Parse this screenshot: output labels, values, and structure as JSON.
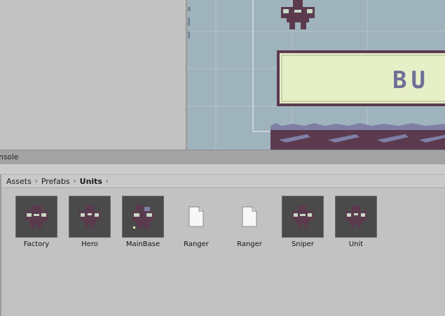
{
  "console_tab": {
    "label": "onsole"
  },
  "scene": {
    "button_text": "BU"
  },
  "breadcrumb": [
    {
      "label": "Assets"
    },
    {
      "label": "Prefabs"
    },
    {
      "label": "Units"
    }
  ],
  "breadcrumb_sep": "›",
  "assets": [
    {
      "label": "Factory",
      "icon": "sprite-prefab-icon"
    },
    {
      "label": "Hero",
      "icon": "sprite-prefab-icon"
    },
    {
      "label": "MainBase",
      "icon": "sprite-prefab-icon"
    },
    {
      "label": "Ranger",
      "icon": "document-icon"
    },
    {
      "label": "Ranger",
      "icon": "document-icon"
    },
    {
      "label": "Sniper",
      "icon": "sprite-prefab-icon"
    },
    {
      "label": "Unit",
      "icon": "sprite-prefab-icon"
    }
  ],
  "colors": {
    "sprite_dark": "#5b3a4e",
    "sprite_light": "#c6d8c6",
    "scene_bg": "#9fb3bd",
    "banner_fill": "#e7efc7",
    "banner_text": "#6f6f98"
  }
}
